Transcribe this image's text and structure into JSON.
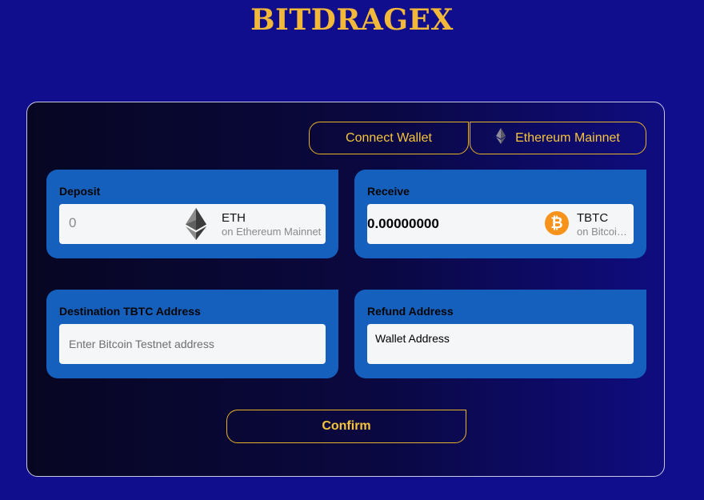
{
  "brand": {
    "name": "BITDRAGEX"
  },
  "colors": {
    "background": "#100e8c",
    "accent": "#f7c43b",
    "card": "#1660bd",
    "field": "#f4f6f8",
    "btc": "#f7931a"
  },
  "header": {
    "connect_label": "Connect Wallet",
    "network_label": "Ethereum Mainnet",
    "network_icon": "ethereum-icon"
  },
  "deposit": {
    "label": "Deposit",
    "placeholder": "0",
    "token_symbol": "ETH",
    "token_network": "on Ethereum Mainnet",
    "token_icon": "ethereum-icon"
  },
  "receive": {
    "label": "Receive",
    "amount": "0.00000000",
    "token_symbol": "TBTC",
    "token_network": "on Bitcoin Testnet",
    "token_icon": "bitcoin-icon",
    "token_icon_glyph": "₿"
  },
  "destination": {
    "label": "Destination TBTC Address",
    "placeholder": "Enter Bitcoin Testnet address"
  },
  "refund": {
    "label": "Refund Address",
    "value": "Wallet Address"
  },
  "actions": {
    "confirm_label": "Confirm"
  }
}
